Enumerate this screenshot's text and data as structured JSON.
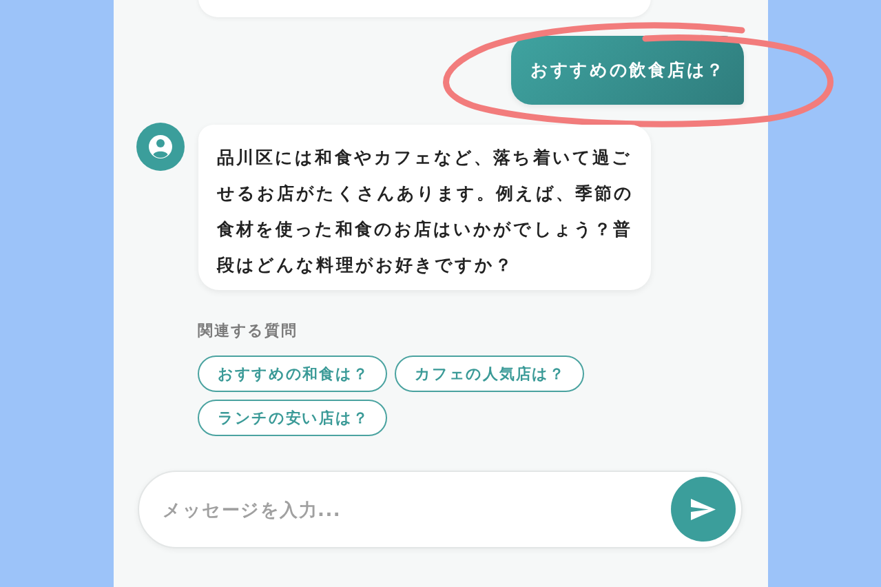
{
  "messages": [
    {
      "kind": "user",
      "text": "おすすめの飲食店は？",
      "highlighted": true
    },
    {
      "kind": "bot",
      "text": "品川区には和食やカフェなど、落ち着いて過ごせるお店がたくさんあります。例えば、季節の食材を使った和食のお店はいかがでしょう？普段はどんな料理がお好きですか？",
      "highlighted": false
    }
  ],
  "related_questions": {
    "title": "関連する質問",
    "items": [
      "おすすめの和食は？",
      "カフェの人気店は？",
      "ランチの安い店は？"
    ]
  },
  "composer": {
    "placeholder": "メッセージを入力..."
  }
}
